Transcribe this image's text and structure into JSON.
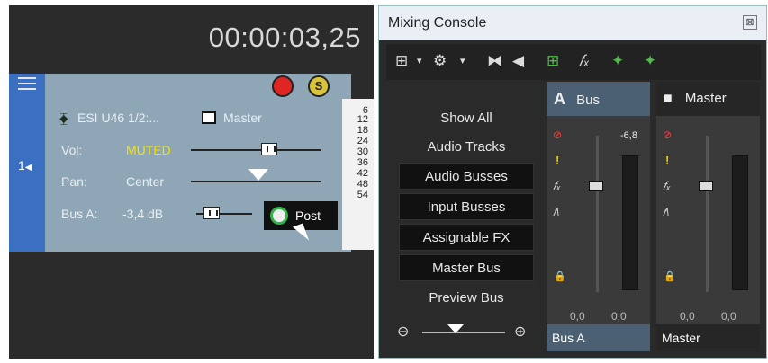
{
  "track_panel": {
    "timecode": "00:00:03,25",
    "track_number": "1",
    "device": "ESI U46 1/2:...",
    "output": "Master",
    "vol_label": "Vol:",
    "vol_value": "MUTED",
    "pan_label": "Pan:",
    "pan_value": "Center",
    "bus_label": "Bus A:",
    "bus_value": "-3,4 dB",
    "post_label": "Post",
    "meter_scale": [
      "6",
      "12",
      "18",
      "24",
      "30",
      "36",
      "42",
      "48",
      "54"
    ],
    "colors": {
      "track_bg": "#8ea6b5",
      "track_strip": "#3b6fc2",
      "muted_text": "#f3e100"
    }
  },
  "mixing_console": {
    "title": "Mixing Console",
    "nav_items": [
      {
        "label": "Show All",
        "selected": false
      },
      {
        "label": "Audio Tracks",
        "selected": false
      },
      {
        "label": "Audio Busses",
        "selected": true
      },
      {
        "label": "Input Busses",
        "selected": true
      },
      {
        "label": "Assignable FX",
        "selected": true
      },
      {
        "label": "Master Bus",
        "selected": true
      },
      {
        "label": "Preview Bus",
        "selected": false
      }
    ],
    "channels": [
      {
        "header_letter": "A",
        "header_label": "Bus",
        "peak_value": "-6,8",
        "left_value": "0,0",
        "right_value": "0,0",
        "name": "Bus A",
        "header_bg": "#4b6073"
      },
      {
        "header_letter": "■",
        "header_label": "Master",
        "peak_value": "",
        "left_value": "0,0",
        "right_value": "0,0",
        "name": "Master",
        "header_bg": "#262626"
      }
    ]
  }
}
